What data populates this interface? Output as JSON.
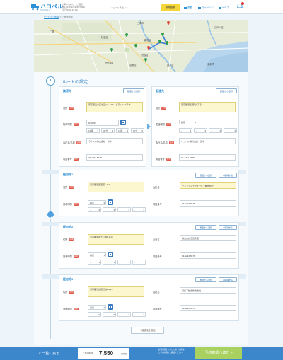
{
  "header": {
    "logo": "ハコベル",
    "logo_sub": "HACOBELL",
    "info_line1": "お問い合わせ・ご相談",
    "info_line2": "050-3145-1123 受付時間",
    "info_line3": "(平日 9:00-18:00)",
    "business": "ハコベル不在ドット",
    "nav": {
      "order": "新規依頼",
      "history": "履歴",
      "mypage": "マイページ",
      "help": "ヘルプ"
    },
    "accent": "#f4d63a",
    "brand": "#2d8fd4"
  },
  "breadcrumb": {
    "link": "サービスご依頼",
    "current": "＞ ご依頼内容"
  },
  "map": {
    "labels": [
      "三郷市",
      "二筋",
      "杉並区",
      "江戸川区",
      "新宿区",
      "渋谷区",
      "目黒区",
      "品川区",
      "世田谷区",
      "東京湾"
    ]
  },
  "route": {
    "step_number": "1",
    "title": "ルートの設定",
    "pickup": {
      "heading": "集荷先",
      "history_btn": "履歴から選択",
      "address_label": "住所",
      "address_value": "東京都品川区北品川1-22-6　グランドプラザ",
      "datetime_label": "集荷時間",
      "date_value": "9/18(水)",
      "time_from": "13時",
      "time_from_min": "00分",
      "time_to": "15時",
      "time_to_min": "00分",
      "company_label": "会社名/名前",
      "company_value": "ラクスル株式会社　鈴木",
      "phone_label": "電話番号",
      "phone_value": "03-1234-5678"
    },
    "delivery": {
      "heading": "配達先",
      "history_btn": "履歴から選択",
      "address_label": "住所",
      "address_value": "東京都港区港南1丁目1-1",
      "datetime_label": "配達時間",
      "datetime_value": "指定",
      "company_label": "会社名/名前",
      "company_value": "ハコベル株式会社　田中",
      "phone_label": "電話番号",
      "phone_value": "03-1234-5678"
    },
    "waypoints": [
      {
        "heading": "経由地1",
        "history_btn": "履歴から選択",
        "remove_btn": "× 削除する",
        "address_label": "住所",
        "address_value": "東京都港区芝浦1-2-3",
        "company_label": "会社名",
        "company_value": "グッドデイエクスプレス株式会社",
        "datetime_label": "到着時間",
        "datetime_value": "指定",
        "phone_label": "電話番号",
        "phone_value": "03-1234-5678"
      },
      {
        "heading": "経由地2",
        "history_btn": "履歴から選択",
        "remove_btn": "× 削除する",
        "address_label": "住所",
        "address_value": "東京都港区芝公園1-1-16",
        "company_label": "会社名",
        "company_value": "株式会社三田倉庫",
        "datetime_label": "到着時間",
        "datetime_value": "指定",
        "phone_label": "電話番号",
        "phone_value": "03-1234-5678"
      },
      {
        "heading": "経由地3",
        "history_btn": "履歴から選択",
        "remove_btn": "× 削除する",
        "address_label": "住所",
        "address_value": "東京都渋谷区渋谷2-23-1",
        "company_label": "会社名",
        "company_value": "渋谷不動産株式会社",
        "datetime_label": "到着時間",
        "datetime_value": "指定",
        "phone_label": "電話番号",
        "phone_value": "03-1234-5678"
      }
    ],
    "add_waypoint": "経由地を追加",
    "required_badge": "必須"
  },
  "footer": {
    "back": "< 一覧に戻る",
    "fee_label": "ご利用料金",
    "fee_value": "7,550",
    "fee_unit": "円(税抜)",
    "note_line1": "必須項目を入力した後でお荷物",
    "note_line2": "と車両内容をご確認ください",
    "confirm": "予約確認へ進む >",
    "confirm_color": "#a8d15f"
  }
}
